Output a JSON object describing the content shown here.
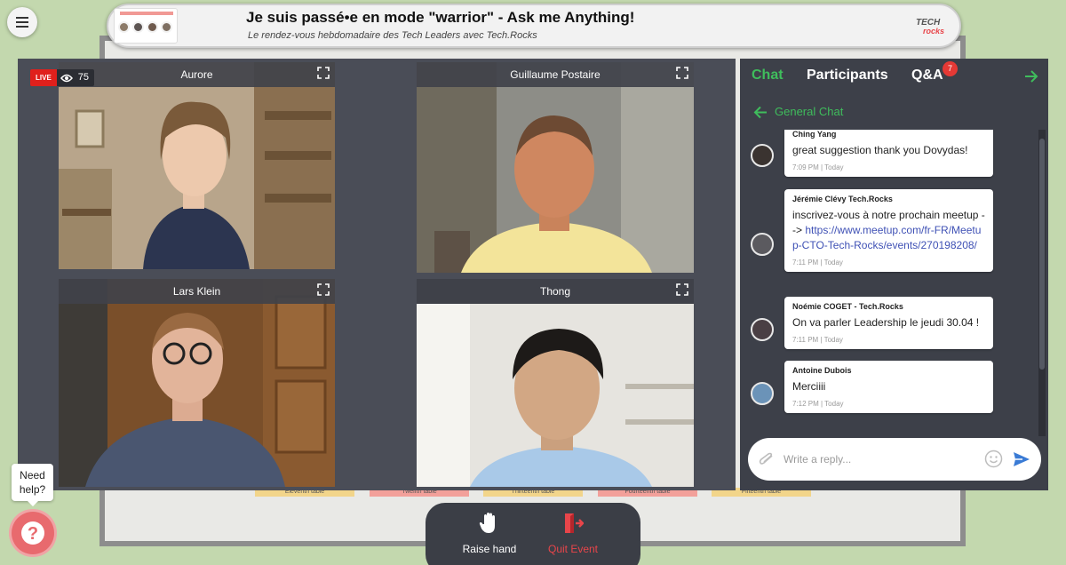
{
  "event": {
    "title": "Je suis passé•e en mode \"warrior\" - Ask me Anything!",
    "subtitle": "Le rendez-vous hebdomadaire des Tech Leaders avec Tech.Rocks",
    "logo_text": "TECH rocks"
  },
  "venue": {
    "tables": [
      "Eleventh table",
      "Twelfth table",
      "Thirteenth table",
      "Fourteenth table",
      "Fifteenth table"
    ]
  },
  "stage": {
    "live_label": "LIVE",
    "viewer_count": "75",
    "participants": [
      {
        "name": "Aurore"
      },
      {
        "name": "Guillaume Postaire"
      },
      {
        "name": "Lars Klein"
      },
      {
        "name": "Thong"
      }
    ]
  },
  "chat": {
    "tabs": [
      {
        "label": "Chat",
        "active": true
      },
      {
        "label": "Participants",
        "active": false
      },
      {
        "label": "Q&A",
        "active": false
      }
    ],
    "qa_badge": "7",
    "channel": "General Chat",
    "messages": [
      {
        "author": "Ching Yang",
        "text": "great suggestion thank you Dovydas!",
        "time": "7:09 PM | Today"
      },
      {
        "author": "Jérémie Clévy Tech.Rocks",
        "text": "inscrivez-vous à notre prochain meetup --> ",
        "link": "https://www.meetup.com/fr-FR/Meetup-CTO-Tech-Rocks/events/270198208/",
        "time": "7:11 PM | Today"
      },
      {
        "author": "Noémie COGET - Tech.Rocks",
        "text": "On va parler Leadership le jeudi 30.04 !",
        "time": "7:11 PM | Today"
      },
      {
        "author": "Antoine Dubois",
        "text": "Merciiii",
        "time": "7:12 PM | Today"
      }
    ],
    "reply_placeholder": "Write a reply..."
  },
  "controls": {
    "raise_hand": "Raise hand",
    "quit_event": "Quit Event"
  },
  "help": {
    "tooltip": "Need help?"
  },
  "colors": {
    "accent_green": "#3fbd5c",
    "live_red": "#e0201c",
    "quit_red": "#e8454a",
    "panel_bg": "#3d4049",
    "link_blue": "#3f51b5"
  }
}
